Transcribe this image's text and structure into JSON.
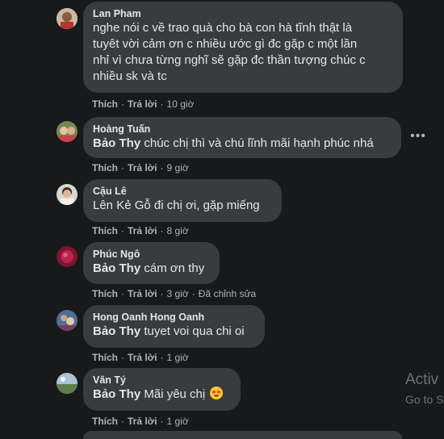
{
  "comments": [
    {
      "author": "Lan Pham",
      "text": "nghe nói c về trao quà cho bà con hà tĩnh thật là tuyêt vời cảm ơn c nhiều ước gì đc gặp c một lần nhỉ vì chưa từng nghĩ sẽ gặp đc thần tượng chúc c nhiều sk và tc",
      "lines": [
        "nghe nói c về trao quà cho bà con hà tĩnh thật là",
        "tuyêt vời cảm ơn c nhiều ước gì đc gặp c một lần",
        "nhỉ vì chưa từng nghĩ sẽ gặp đc thần tượng chúc c",
        "nhiều sk và tc"
      ],
      "like": "Thích",
      "reply": "Trả lời",
      "time": "10 giờ"
    },
    {
      "author": "Hoàng Tuấn",
      "mention": "Bảo Thy",
      "text": " chúc chị thì và chú lĩnh mãi hạnh phúc nhá",
      "like": "Thích",
      "reply": "Trả lời",
      "time": "9 giờ"
    },
    {
      "author": "Cậu Lê",
      "text": "Lên Kẻ Gỗ đi chị ơi, gặp miếng",
      "like": "Thích",
      "reply": "Trả lời",
      "time": "8 giờ"
    },
    {
      "author": "Phúc Ngô",
      "mention": "Bảo Thy",
      "text": " cám ơn thy",
      "like": "Thích",
      "reply": "Trả lời",
      "time": "3 giờ",
      "edited": "Đã chỉnh sửa"
    },
    {
      "author": "Hong Oanh Hong Oanh",
      "mention": "Bảo Thy",
      "text": " tuyet voi qua chi oi",
      "like": "Thích",
      "reply": "Trả lời",
      "time": "1 giờ"
    },
    {
      "author": "Văn Tý",
      "mention": "Bảo Thy",
      "text": " Mãi yêu chị",
      "emoji": "star-struck-emoji",
      "like": "Thích",
      "reply": "Trả lời",
      "time": "1 giờ"
    }
  ],
  "more_options": "•••",
  "watermark": {
    "line1": "Activ",
    "line2": "Go to S"
  }
}
